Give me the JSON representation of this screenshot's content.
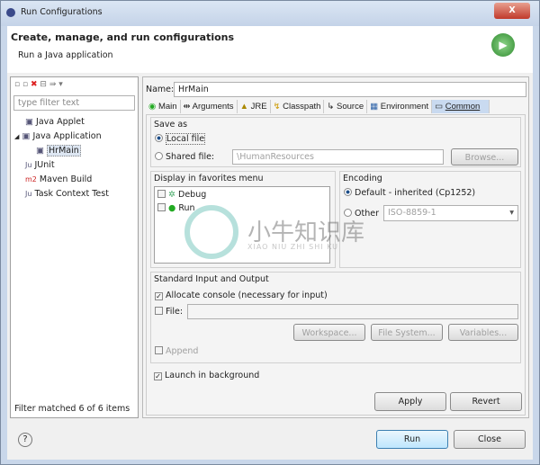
{
  "window": {
    "title": "Run Configurations",
    "close": "X"
  },
  "header": {
    "title": "Create, manage, and run configurations",
    "subtitle": "Run a Java application"
  },
  "sidebar": {
    "filter_placeholder": "type filter text",
    "items": [
      {
        "label": "Java Applet"
      },
      {
        "label": "Java Application"
      },
      {
        "label": "HrMain"
      },
      {
        "label": "JUnit"
      },
      {
        "label": "Maven Build"
      },
      {
        "label": "Task Context Test"
      }
    ],
    "status": "Filter matched 6 of 6 items"
  },
  "main": {
    "name_label": "Name:",
    "name_value": "HrMain",
    "tabs": [
      {
        "label": "Main"
      },
      {
        "label": "Arguments"
      },
      {
        "label": "JRE"
      },
      {
        "label": "Classpath"
      },
      {
        "label": "Source"
      },
      {
        "label": "Environment"
      },
      {
        "label": "Common"
      }
    ],
    "save_as": {
      "title": "Save as",
      "local": "Local file",
      "shared": "Shared file:",
      "shared_value": "\\HumanResources",
      "browse": "Browse..."
    },
    "favorites": {
      "title": "Display in favorites menu",
      "items": [
        {
          "label": "Debug"
        },
        {
          "label": "Run"
        }
      ]
    },
    "encoding": {
      "title": "Encoding",
      "default": "Default - inherited (Cp1252)",
      "other": "Other",
      "other_value": "ISO-8859-1"
    },
    "stdio": {
      "title": "Standard Input and Output",
      "allocate": "Allocate console (necessary for input)",
      "file": "File:",
      "workspace": "Workspace...",
      "filesystem": "File System...",
      "variables": "Variables...",
      "append": "Append"
    },
    "launch_bg": "Launch in background",
    "apply": "Apply",
    "revert": "Revert"
  },
  "footer": {
    "help": "?",
    "run": "Run",
    "close": "Close"
  },
  "watermark": {
    "text": "小牛知识库",
    "sub": "XIAO NIU ZHI SHI KU"
  }
}
